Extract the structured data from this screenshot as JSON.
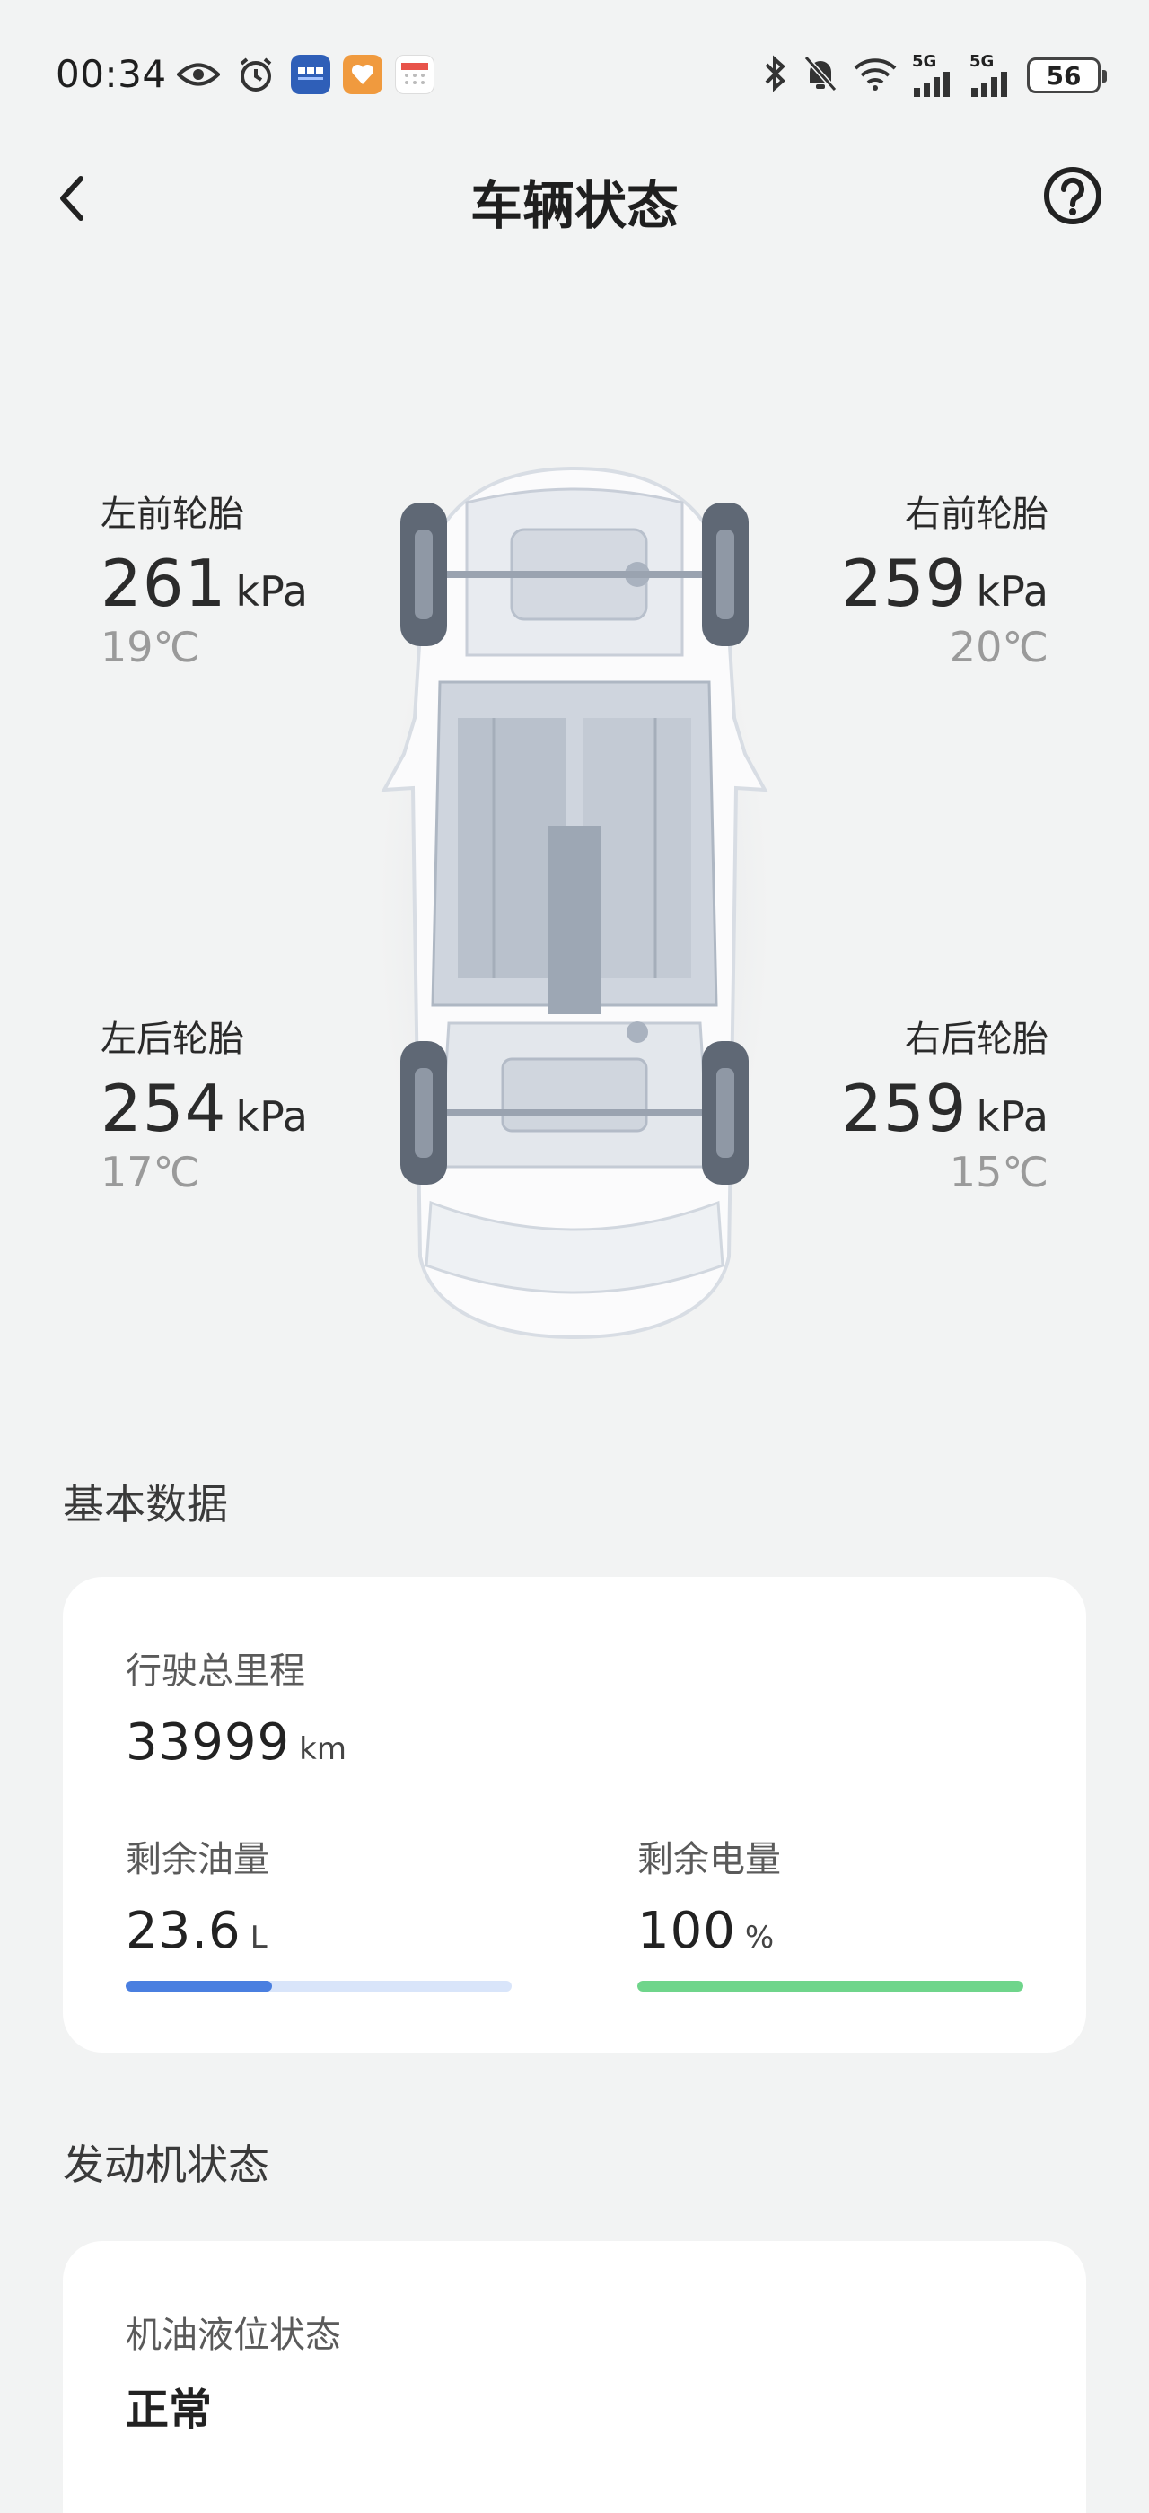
{
  "status_bar": {
    "time": "00:34",
    "left_icons": [
      "eye-icon",
      "alarm-clock-icon",
      "app-icon-blue",
      "app-icon-orange",
      "calendar-icon"
    ],
    "right_icons": [
      "bluetooth-icon",
      "mute-bell-icon",
      "wifi-icon",
      "signal-5g-icon",
      "signal-5g-icon"
    ],
    "signal_tag": "5G",
    "battery_level": "56"
  },
  "header": {
    "title": "车辆状态",
    "back_icon": "chevron-left-icon",
    "help_icon": "question-circle-icon"
  },
  "tires": {
    "front_left": {
      "label": "左前轮胎",
      "pressure": "261",
      "unit": "kPa",
      "temp": "19℃"
    },
    "front_right": {
      "label": "右前轮胎",
      "pressure": "259",
      "unit": "kPa",
      "temp": "20℃"
    },
    "rear_left": {
      "label": "左后轮胎",
      "pressure": "254",
      "unit": "kPa",
      "temp": "17℃"
    },
    "rear_right": {
      "label": "右后轮胎",
      "pressure": "259",
      "unit": "kPa",
      "temp": "15℃"
    }
  },
  "basic_data": {
    "section_title": "基本数据",
    "mileage": {
      "label": "行驶总里程",
      "value": "33999",
      "unit": "km"
    },
    "fuel": {
      "label": "剩余油量",
      "value": "23.6",
      "unit": "L",
      "fill_fraction": 0.38
    },
    "battery": {
      "label": "剩余电量",
      "value": "100",
      "unit": "%",
      "fill_fraction": 1.0
    }
  },
  "engine": {
    "section_title": "发动机状态",
    "oil_level": {
      "label": "机油液位状态",
      "value": "正常"
    }
  },
  "colors": {
    "background": "#f2f3f3",
    "fuel_fill": "#4a7fe0",
    "fuel_track": "#d9e5fa",
    "battery_fill": "#6fd58b",
    "battery_track": "#d9f4e1",
    "temp_text": "#9a9a9a"
  }
}
